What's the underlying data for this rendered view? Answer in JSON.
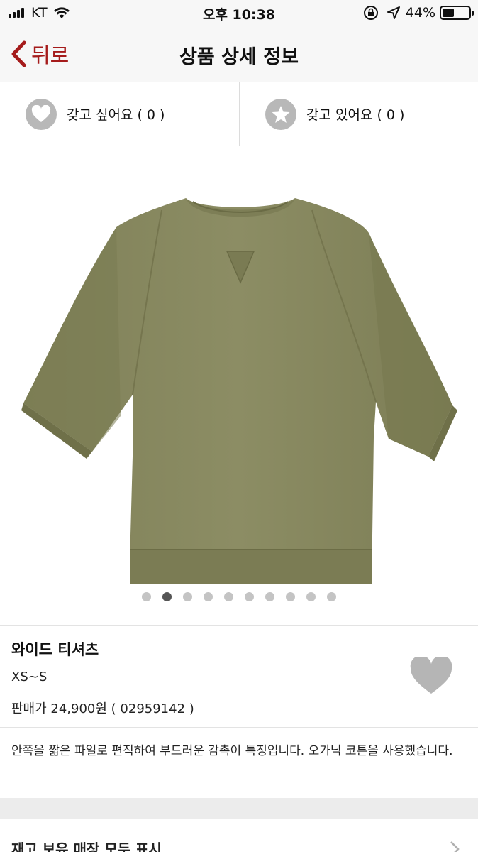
{
  "status_bar": {
    "carrier": "KT",
    "time": "오후 10:38",
    "battery_percent": "44%",
    "battery_level": 0.44
  },
  "nav": {
    "back_label": "뒤로",
    "title": "상품 상세 정보"
  },
  "actions": {
    "want_label": "갖고 싶어요 ( 0 )",
    "have_label": "갖고 있어요 ( 0 )"
  },
  "carousel": {
    "total": 10,
    "active_index": 1
  },
  "product": {
    "name": "와이드 티셔츠",
    "size": "XS~S",
    "price_line": "판매가 24,900원 ( 02959142 )",
    "description": "안쪽을 짧은 파일로 편직하여 부드러운 감촉이 특징입니다. 오가닉 코튼을 사용했습니다.",
    "color": "#8a8a63"
  },
  "stock": {
    "label": "재고 보유 매장 모두 표시"
  },
  "colors": {
    "accent": "#a51b1b",
    "icon_gray": "#b8b8b8"
  }
}
